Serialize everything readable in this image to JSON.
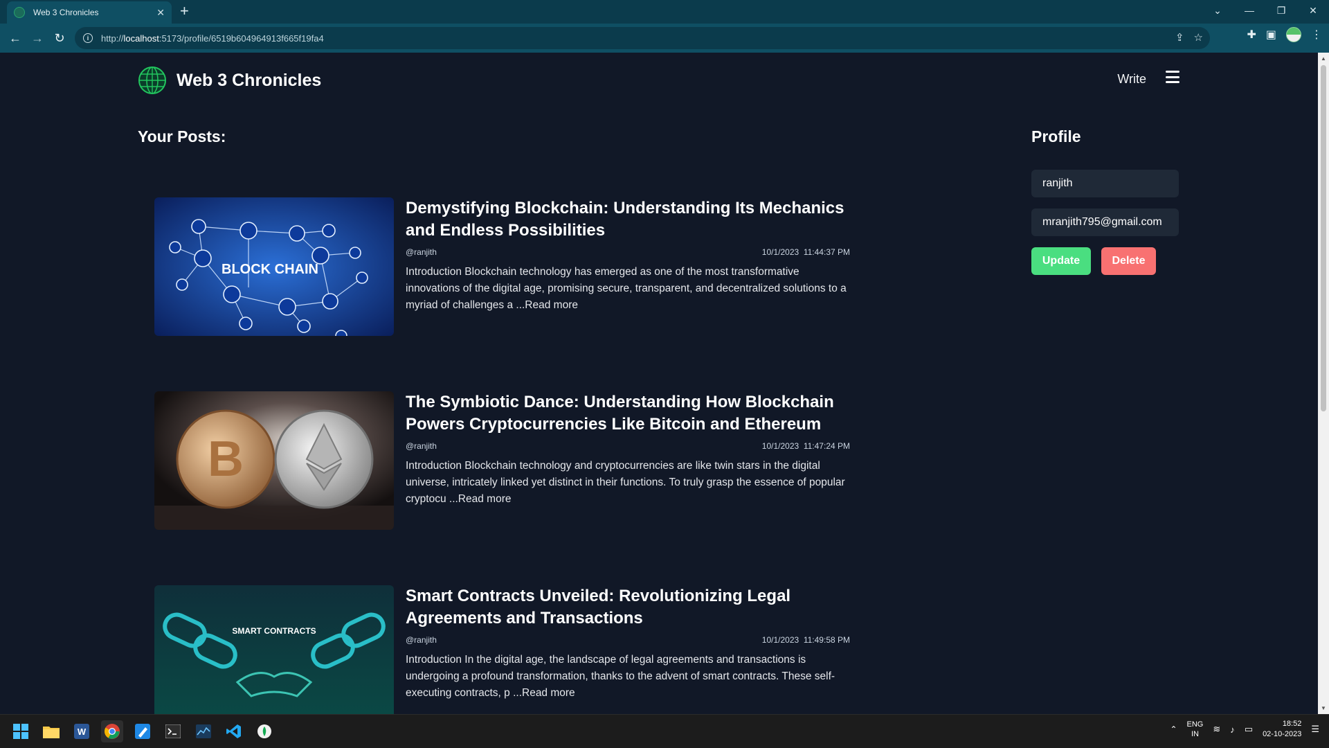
{
  "browser": {
    "tab_title": "Web 3 Chronicles",
    "url_prefix": "http://",
    "url_host": "localhost",
    "url_rest": ":5173/profile/6519b604964913f665f19fa4"
  },
  "header": {
    "brand": "Web 3 Chronicles",
    "write_label": "Write"
  },
  "posts_heading": "Your Posts:",
  "posts": [
    {
      "title": "Demystifying Blockchain: Understanding Its Mechanics and Endless Possibilities",
      "author": "@ranjith",
      "date": "10/1/2023",
      "time": "11:44:37 PM",
      "excerpt": "Introduction Blockchain technology has emerged as one of the most transformative innovations of the digital age, promising secure, transparent, and decentralized solutions to a myriad of challenges a ...Read more",
      "image_caption": "BLOCK CHAIN"
    },
    {
      "title": "The Symbiotic Dance: Understanding How Blockchain Powers Cryptocurrencies Like Bitcoin and Ethereum",
      "author": "@ranjith",
      "date": "10/1/2023",
      "time": "11:47:24 PM",
      "excerpt": "Introduction Blockchain technology and cryptocurrencies are like twin stars in the digital universe, intricately linked yet distinct in their functions. To truly grasp the essence of popular cryptocu ...Read more",
      "image_caption": ""
    },
    {
      "title": "Smart Contracts Unveiled: Revolutionizing Legal Agreements and Transactions",
      "author": "@ranjith",
      "date": "10/1/2023",
      "time": "11:49:58 PM",
      "excerpt": "Introduction In the digital age, the landscape of legal agreements and transactions is undergoing a profound transformation, thanks to the advent of smart contracts. These self-executing contracts, p ...Read more",
      "image_caption": "SMART CONTRACTS"
    }
  ],
  "profile": {
    "heading": "Profile",
    "username": "ranjith",
    "email": "mranjith795@gmail.com",
    "update_label": "Update",
    "delete_label": "Delete"
  },
  "taskbar": {
    "lang_top": "ENG",
    "lang_bottom": "IN",
    "time": "18:52",
    "date": "02-10-2023"
  },
  "colors": {
    "page_bg": "#111827",
    "field_bg": "#1f2937",
    "update": "#4ade80",
    "delete": "#f87171",
    "browser_chrome": "#0f4f63"
  }
}
